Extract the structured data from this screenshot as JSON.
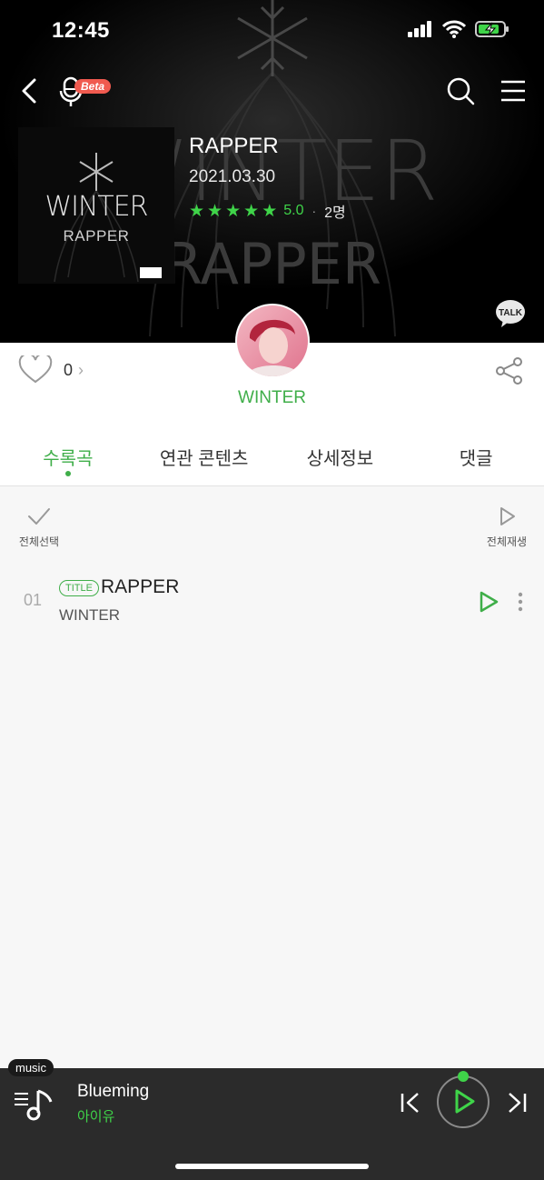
{
  "status_bar": {
    "time": "12:45"
  },
  "nav": {
    "beta_badge": "Beta",
    "icons": [
      "back-icon",
      "microphone-icon",
      "search-icon",
      "menu-icon"
    ]
  },
  "hero": {
    "bg_text_top": "WINTER",
    "bg_text_bottom": "RAPPER",
    "cover_title": "WINTER",
    "cover_subtitle": "RAPPER",
    "album_title": "RAPPER",
    "release_date": "2021.03.30",
    "rating_stars": 5,
    "rating_score": "5.0",
    "rating_separator": "·",
    "rating_count": "2명",
    "talk_label": "TALK"
  },
  "artist": {
    "name": "WINTER"
  },
  "like": {
    "count": "0",
    "chevron": "›"
  },
  "tabs": [
    {
      "label": "수록곡",
      "active": true
    },
    {
      "label": "연관 콘텐츠",
      "active": false
    },
    {
      "label": "상세정보",
      "active": false
    },
    {
      "label": "댓글",
      "active": false
    }
  ],
  "list_toolbar": {
    "select_all": "전체선택",
    "play_all": "전체재생"
  },
  "tracks": [
    {
      "number": "01",
      "badge": "TITLE",
      "title": "RAPPER",
      "artist": "WINTER"
    }
  ],
  "player": {
    "tag": "music",
    "song": "Blueming",
    "artist": "아이유"
  },
  "colors": {
    "accent": "#3fae49",
    "accent_bright": "#3fd449",
    "player_bg": "#2b2b2b",
    "beta": "#f05a4f"
  }
}
